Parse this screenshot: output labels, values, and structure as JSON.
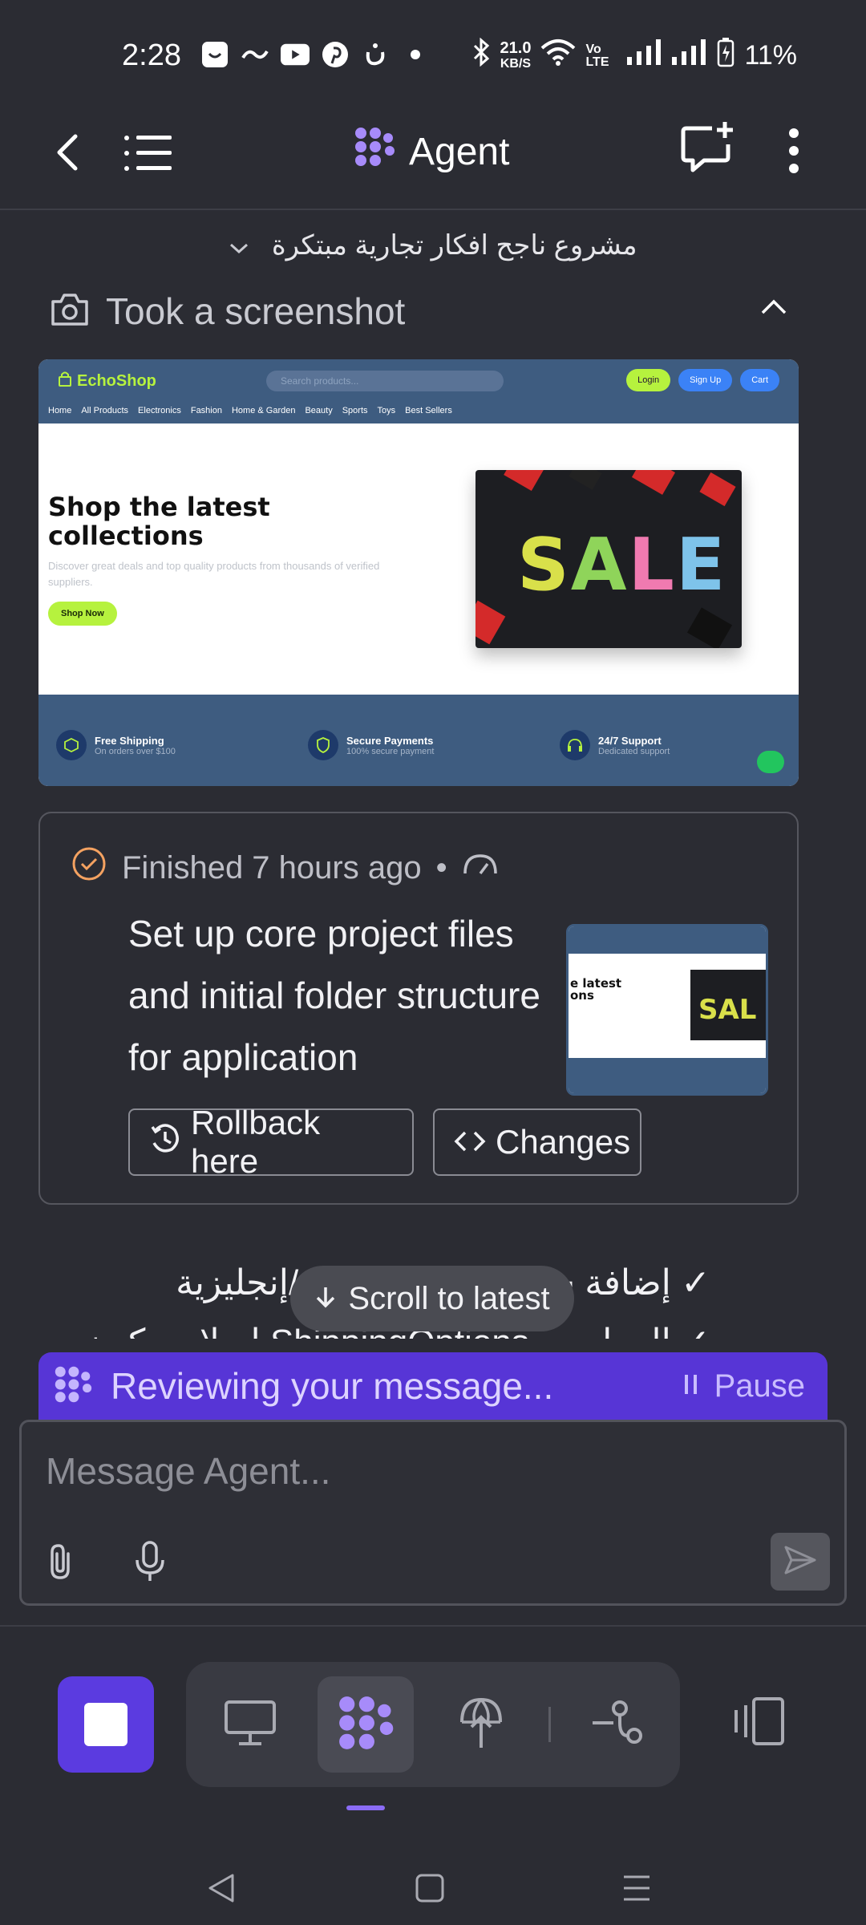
{
  "status_bar": {
    "time": "2:28",
    "net_speed_value": "21.0",
    "net_speed_unit": "KB/S",
    "volte": "Vo\nLTE",
    "battery": "11%"
  },
  "app_bar": {
    "title": "Agent"
  },
  "project": {
    "title": "مشروع ناجح افكار تجارية مبتكرة"
  },
  "tool_event": {
    "label": "Took a screenshot"
  },
  "screenshot": {
    "logo": "EchoShop",
    "search_placeholder": "Search products...",
    "login": "Login",
    "signup": "Sign Up",
    "cart": "Cart",
    "categories": [
      "Home",
      "All Products",
      "Electronics",
      "Fashion",
      "Home & Garden",
      "Beauty",
      "Sports",
      "Toys",
      "Best Sellers"
    ],
    "hero_title": "Shop the latest collections",
    "hero_sub": "Discover great deals and top quality products from thousands of verified suppliers.",
    "shop_now": "Shop Now",
    "sale_word": "SALE",
    "features": [
      {
        "title": "Free Shipping",
        "sub": "On orders over $100"
      },
      {
        "title": "Secure Payments",
        "sub": "100% secure payment"
      },
      {
        "title": "24/7 Support",
        "sub": "Dedicated support"
      }
    ]
  },
  "checkpoint": {
    "status": "Finished 7 hours ago",
    "separator": "•",
    "description": "Set up core project files and initial folder structure for application",
    "rollback_label": "Rollback here",
    "changes_label": "Changes",
    "thumb_title": "e latest\nons",
    "thumb_sale": "SAL"
  },
  "message_lines": {
    "line1": "✓ إضافة شريط اللغة العربية/إنجليزية",
    "line2": "✓ العمل مع ShippingOptions إصلاح مكون"
  },
  "scroll_to_latest": "Scroll to latest",
  "reviewing": {
    "text": "Reviewing your message...",
    "pause": "Pause"
  },
  "composer": {
    "placeholder": "Message Agent..."
  },
  "colors": {
    "accent": "#5b3be0",
    "review_bar": "#5735d6",
    "background": "#2b2c33",
    "echoshop_green": "#b6f23e",
    "echoshop_blue": "#3e5c80"
  }
}
